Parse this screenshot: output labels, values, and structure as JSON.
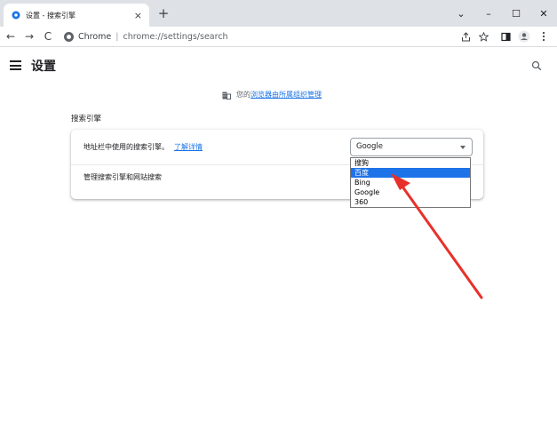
{
  "tab": {
    "title": "设置 - 搜索引擎",
    "close_label": "×",
    "new_tab_label": "+"
  },
  "window_controls": {
    "menu": "⌄",
    "minimize": "–",
    "maximize": "☐",
    "close": "✕"
  },
  "toolbar": {
    "back": "←",
    "forward": "→",
    "reload": "C",
    "site_name": "Chrome",
    "separator": "|",
    "url": "chrome://settings/search"
  },
  "app": {
    "title": "设置"
  },
  "managed": {
    "prefix": "您的",
    "link": "浏览器由所属组织管理"
  },
  "section": {
    "title": "搜索引擎"
  },
  "card": {
    "row1_label": "地址栏中使用的搜索引擎。",
    "row1_link": "了解详情",
    "row2_label": "管理搜索引擎和网站搜索"
  },
  "select": {
    "value": "Google",
    "options": [
      "搜狗",
      "百度",
      "Bing",
      "Google",
      "360"
    ],
    "highlighted": "百度"
  },
  "colors": {
    "accent": "#1a73e8",
    "highlight": "#1e73e8",
    "annotation": "#e8302a"
  }
}
